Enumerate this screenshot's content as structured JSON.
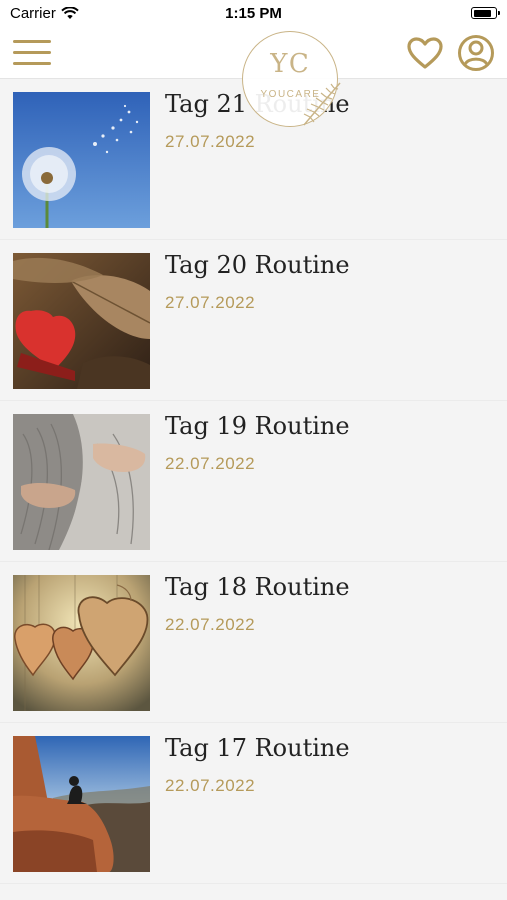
{
  "status_bar": {
    "carrier": "Carrier",
    "time": "1:15 PM",
    "battery_level": 0.85
  },
  "header": {
    "logo": {
      "monogram": "YC",
      "brand": "YOUCARE"
    },
    "icons": {
      "menu": "menu-icon",
      "favorites": "heart-icon",
      "profile": "user-circle-icon"
    },
    "accent_color": "#b59a5a"
  },
  "routines": [
    {
      "title": "Tag 21 Routine",
      "date": "27.07.2022",
      "image": "dandelion-sky"
    },
    {
      "title": "Tag 20 Routine",
      "date": "27.07.2022",
      "image": "red-heart-leaves"
    },
    {
      "title": "Tag 19 Routine",
      "date": "22.07.2022",
      "image": "knit-blanket-hug"
    },
    {
      "title": "Tag 18 Routine",
      "date": "22.07.2022",
      "image": "wooden-hearts"
    },
    {
      "title": "Tag 17 Routine",
      "date": "22.07.2022",
      "image": "meditation-canyon"
    }
  ]
}
